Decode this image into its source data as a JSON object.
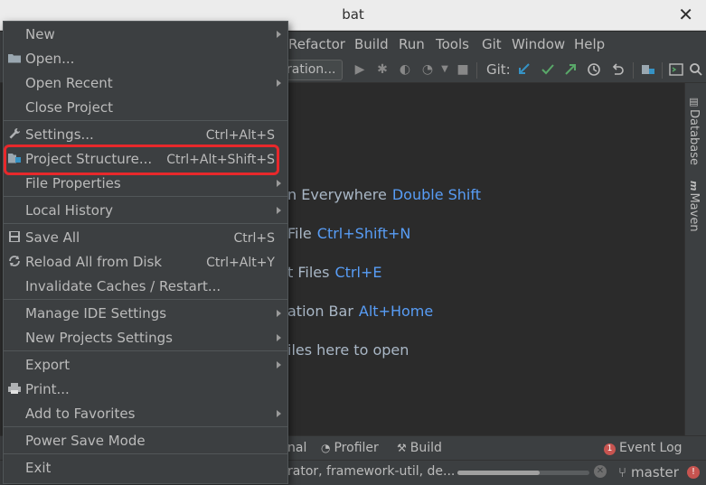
{
  "window": {
    "title": "bat",
    "close_glyph": "✕"
  },
  "menubar": [
    "Refactor",
    "Build",
    "Run",
    "Tools",
    "Git",
    "Window",
    "Help"
  ],
  "toolbar": {
    "run_config": "ration...",
    "git_label": "Git:"
  },
  "file_menu": {
    "items": [
      {
        "label": "New",
        "shortcut": "",
        "submenu": true,
        "icon": ""
      },
      {
        "label": "Open...",
        "shortcut": "",
        "submenu": false,
        "icon": "folder-icon"
      },
      {
        "label": "Open Recent",
        "shortcut": "",
        "submenu": true,
        "icon": ""
      },
      {
        "label": "Close Project",
        "shortcut": "",
        "submenu": false,
        "icon": ""
      },
      {
        "label": "Settings...",
        "shortcut": "Ctrl+Alt+S",
        "submenu": false,
        "icon": "wrench-icon"
      },
      {
        "label": "Project Structure...",
        "shortcut": "Ctrl+Alt+Shift+S",
        "submenu": false,
        "icon": "project-structure-icon"
      },
      {
        "label": "File Properties",
        "shortcut": "",
        "submenu": true,
        "icon": ""
      },
      {
        "label": "Local History",
        "shortcut": "",
        "submenu": true,
        "icon": ""
      },
      {
        "label": "Save All",
        "shortcut": "Ctrl+S",
        "submenu": false,
        "icon": "save-icon"
      },
      {
        "label": "Reload All from Disk",
        "shortcut": "Ctrl+Alt+Y",
        "submenu": false,
        "icon": "reload-icon"
      },
      {
        "label": "Invalidate Caches / Restart...",
        "shortcut": "",
        "submenu": false,
        "icon": ""
      },
      {
        "label": "Manage IDE Settings",
        "shortcut": "",
        "submenu": true,
        "icon": ""
      },
      {
        "label": "New Projects Settings",
        "shortcut": "",
        "submenu": true,
        "icon": ""
      },
      {
        "label": "Export",
        "shortcut": "",
        "submenu": true,
        "icon": ""
      },
      {
        "label": "Print...",
        "shortcut": "",
        "submenu": false,
        "icon": "print-icon"
      },
      {
        "label": "Add to Favorites",
        "shortcut": "",
        "submenu": true,
        "icon": ""
      },
      {
        "label": "Power Save Mode",
        "shortcut": "",
        "submenu": false,
        "icon": ""
      },
      {
        "label": "Exit",
        "shortcut": "",
        "submenu": false,
        "icon": ""
      }
    ],
    "highlighted_item": "Project Structure..."
  },
  "editor_hints": [
    {
      "text": "n Everywhere",
      "key": "Double Shift"
    },
    {
      "text": "File",
      "key": "Ctrl+Shift+N"
    },
    {
      "text": "t Files",
      "key": "Ctrl+E"
    },
    {
      "text": "ation Bar",
      "key": "Alt+Home"
    },
    {
      "text": "iles here to open",
      "key": ""
    }
  ],
  "right_panel": [
    "Database",
    "Maven"
  ],
  "bottom_tools": {
    "terminal": "nal",
    "profiler": "Profiler",
    "build": "Build",
    "event_log": "Event Log",
    "event_count": "1"
  },
  "status": {
    "text": "rator, framework-util, de...",
    "progress": 0.62,
    "branch": "master"
  },
  "colors": {
    "accent_key": "#589df6",
    "highlight_border": "#e8282b",
    "git_update": "#3592c4",
    "git_commit": "#59a869",
    "error": "#c75450"
  }
}
